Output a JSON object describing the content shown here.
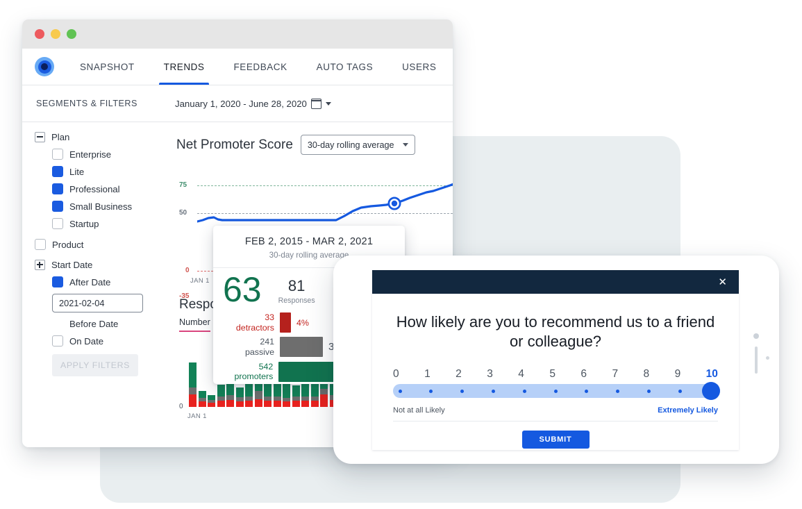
{
  "window": {
    "traffic_lights": [
      "close",
      "minimize",
      "maximize"
    ],
    "logo_icon": "concentric-circle-logo",
    "nav_tabs": [
      {
        "label": "SNAPSHOT",
        "active": false
      },
      {
        "label": "TRENDS",
        "active": true
      },
      {
        "label": "FEEDBACK",
        "active": false
      },
      {
        "label": "AUTO TAGS",
        "active": false
      },
      {
        "label": "USERS",
        "active": false
      }
    ],
    "segments_title": "SEGMENTS & FILTERS",
    "date_range": "January 1, 2020 - June 28, 2020",
    "calendar_icon": "calendar-icon",
    "caret_icon": "chevron-down-icon"
  },
  "filters": {
    "groups": [
      {
        "name": "Plan",
        "toggle": "minus",
        "options": [
          {
            "label": "Enterprise",
            "checked": false
          },
          {
            "label": "Lite",
            "checked": true
          },
          {
            "label": "Professional",
            "checked": true
          },
          {
            "label": "Small Business",
            "checked": true
          },
          {
            "label": "Startup",
            "checked": false
          }
        ]
      }
    ],
    "product": {
      "label": "Product",
      "checked": false
    },
    "start_date": {
      "name": "Start Date",
      "toggle": "plus",
      "after_date_label": "After Date",
      "after_date_checked": true,
      "date_value": "2021-02-04",
      "before_date_label": "Before Date",
      "on_date_label": "On Date",
      "on_date_checked": false
    },
    "apply_label": "APPLY FILTERS"
  },
  "nps_chart": {
    "title": "Net Promoter Score",
    "select_value": "30-day rolling average",
    "caret_icon": "chevron-down-icon",
    "y_ticks": [
      "75",
      "50",
      "0",
      "-35"
    ],
    "x_start_label": "JAN 1"
  },
  "responses_chart": {
    "title": "Responses",
    "subtitle": "Number",
    "zero_label": "0",
    "x_start_label": "JAN 1"
  },
  "tooltip": {
    "range": "FEB 2, 2015 - MAR 2, 2021",
    "subtitle": "30-day rolling average",
    "score": "63",
    "responses_value": "81",
    "responses_label": "Responses",
    "rows": [
      {
        "count": "33",
        "label": "detractors",
        "pct": "4%",
        "kind": "det"
      },
      {
        "count": "241",
        "label": "passive",
        "pct": "30%",
        "kind": "pas"
      },
      {
        "count": "542",
        "label": "promoters",
        "pct": "",
        "kind": "pro"
      }
    ]
  },
  "survey": {
    "close_icon": "close-icon",
    "question": "How likely are you to recommend us to a friend or colleague?",
    "scale": [
      "0",
      "1",
      "2",
      "3",
      "4",
      "5",
      "6",
      "7",
      "8",
      "9",
      "10"
    ],
    "selected": "10",
    "low_label": "Not at all Likely",
    "high_label": "Extremely Likely",
    "submit_label": "SUBMIT"
  },
  "colors": {
    "accent_blue": "#1559e0",
    "promoter_green": "#11734f",
    "passive_gray": "#6e6e6e",
    "detractor_red": "#c3241f",
    "navy": "#12283f",
    "pink_underline": "#d9457e"
  },
  "chart_data": {
    "type": "line",
    "title": "Net Promoter Score",
    "subtitle": "30-day rolling average",
    "ylabel": "",
    "xlabel": "",
    "ylim": [
      -35,
      85
    ],
    "yticks": [
      75,
      50,
      0,
      -35
    ],
    "grid": true,
    "highlight_point": {
      "x": 0.71,
      "y": 59
    },
    "x": [
      0,
      0.03,
      0.06,
      0.09,
      0.12,
      0.15,
      0.18,
      0.21,
      0.24,
      0.27,
      0.3,
      0.33,
      0.36,
      0.39,
      0.42,
      0.45,
      0.48,
      0.51,
      0.54,
      0.57,
      0.6,
      0.63,
      0.66,
      0.69,
      0.71,
      0.74,
      0.77,
      0.8,
      0.83,
      0.86,
      0.89,
      0.92,
      0.95,
      0.98,
      1.0
    ],
    "values": [
      48,
      48.5,
      49,
      49.3,
      48.5,
      48.2,
      48,
      48,
      48,
      48,
      48,
      48,
      48,
      48,
      48,
      48,
      48,
      48.4,
      49.5,
      51.5,
      53.5,
      54.8,
      55.2,
      56,
      57.5,
      59,
      60.5,
      62.5,
      63.5,
      64,
      65.5,
      66.5,
      67.5,
      68,
      66.5
    ]
  },
  "chart_data_secondary": {
    "type": "bar",
    "title": "Responses",
    "subtitle": "Number",
    "stacked": true,
    "series": [
      {
        "name": "detractors",
        "color": "#e8221f",
        "values": [
          18,
          8,
          6,
          9,
          10,
          8,
          9,
          11,
          9,
          9,
          8,
          9,
          9,
          9,
          18,
          10,
          9,
          8,
          9,
          8,
          16,
          9,
          9,
          8
        ]
      },
      {
        "name": "passive",
        "color": "#6e6e6e",
        "values": [
          10,
          5,
          4,
          6,
          7,
          6,
          6,
          12,
          6,
          6,
          5,
          6,
          6,
          6,
          8,
          7,
          6,
          6,
          7,
          7,
          9,
          9,
          8,
          8
        ]
      },
      {
        "name": "promoters",
        "color": "#128257",
        "values": [
          36,
          10,
          7,
          17,
          29,
          14,
          18,
          45,
          40,
          20,
          27,
          16,
          27,
          39,
          22,
          31,
          18,
          24,
          28,
          32,
          40,
          48,
          55,
          58
        ]
      }
    ],
    "ylim": [
      0,
      86
    ],
    "yticks": [
      0
    ],
    "x_start_label": "JAN 1"
  }
}
